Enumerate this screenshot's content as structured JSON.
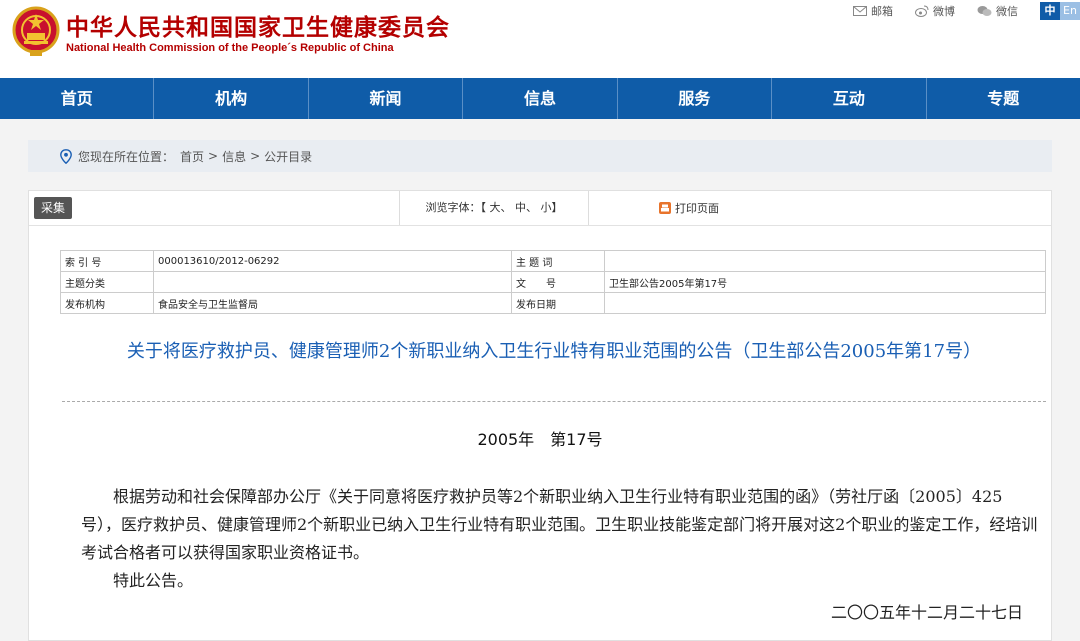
{
  "header": {
    "title_cn": "中华人民共和国国家卫生健康委员会",
    "title_en": "National Health Commission of the People´s Republic of China",
    "emblem_icon": "national-emblem-icon",
    "brand_color": "#b40000",
    "top_links": [
      {
        "label": "邮箱",
        "icon": "mail-icon"
      },
      {
        "label": "微博",
        "icon": "weibo-icon"
      },
      {
        "label": "微信",
        "icon": "wechat-icon"
      }
    ],
    "lang_cn": "中",
    "lang_en": "En"
  },
  "nav": {
    "color": "#0f5ca8",
    "items": [
      "首页",
      "机构",
      "新闻",
      "信息",
      "服务",
      "互动",
      "专题"
    ]
  },
  "breadcrumb": {
    "icon": "location-pin-icon",
    "prefix": "您现在所在位置：",
    "items": [
      "首页",
      "信息",
      "公开目录"
    ],
    "separator": ">"
  },
  "toolbar": {
    "collect_label": "采集",
    "font_label": "浏览字体：【 大、 中、 小】",
    "print_icon": "print-icon",
    "print_label": "打印页面"
  },
  "meta": {
    "rows": [
      {
        "k1": "索 引 号",
        "v1": "000013610/2012-06292",
        "k2": "主 题 词",
        "v2": ""
      },
      {
        "k1": "主题分类",
        "v1": "",
        "k2": "文　　号",
        "v2": "卫生部公告2005年第17号"
      },
      {
        "k1": "发布机构",
        "v1": "食品安全与卫生监督局",
        "k2": "发布日期",
        "v2": ""
      }
    ]
  },
  "article": {
    "title": "关于将医疗救护员、健康管理师2个新职业纳入卫生行业特有职业范围的公告（卫生部公告2005年第17号）",
    "doc_number": "2005年　第17号",
    "paragraphs": [
      "根据劳动和社会保障部办公厅《关于同意将医疗救护员等2个新职业纳入卫生行业特有职业范围的函》（劳社厅函〔2005〕425号），医疗救护员、健康管理师2个新职业已纳入卫生行业特有职业范围。卫生职业技能鉴定部门将开展对这2个职业的鉴定工作，经培训考试合格者可以获得国家职业资格证书。",
      "特此公告。"
    ],
    "date": "二〇〇五年十二月二十七日",
    "title_color": "#1a5fb4"
  }
}
